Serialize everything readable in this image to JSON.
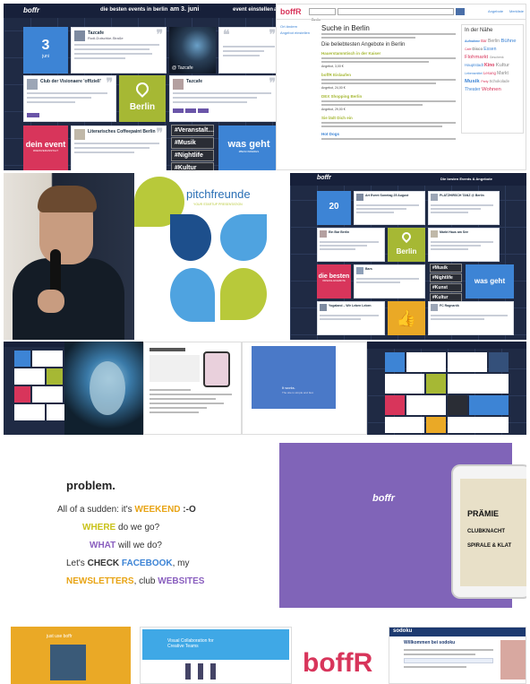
{
  "tile1": {
    "logo": "boffr",
    "header_tagline": "die besten events in berlin",
    "header_date": "am 3. juni",
    "nav": [
      "event einstellen",
      "about"
    ],
    "date_number": "3",
    "date_month": "juni",
    "card_a_title": "Tazcafe",
    "card_a_sub": "Rudi-Dutschke-Straße",
    "card_b_title": "Club der Visionaere 'offiziell'",
    "card_c_title": "Tazcafe",
    "photo_caption": "@ Tazcafe",
    "city_label": "Berlin",
    "card_d_title": "Literarisches Coffeepaint Berlin",
    "dein_event": "dein event",
    "dein_event_sub": "#DEINVERANSTALT",
    "hashtags": [
      "#Veranstalt…",
      "#Musik",
      "#Nightlife",
      "#Kultur"
    ],
    "was_geht": "was geht",
    "was_geht_sub": "#BESONDERES"
  },
  "tile2": {
    "logo": "boffR",
    "search_value": "Berlin",
    "search_button": "Suchen",
    "top_links": [
      "Angebote",
      "Merkliste"
    ],
    "side_links": [
      "Ort ändern",
      "Angebot einstellen"
    ],
    "heading": "Suche in Berlin",
    "section": "Die beliebtesten Angebote in Berlin",
    "right_heading": "In der Nähe",
    "results": [
      {
        "title": "Hauerstammtisch in der Kaiser",
        "price": "Angebot, 3,00 €"
      },
      {
        "title": "boffR Eislaufen",
        "price": "Angebot, 24,00 €"
      },
      {
        "title": "DEX Shopping Berlin",
        "price": "Angebot, 29,00 €"
      },
      {
        "title": "Sie lädt Dich ein",
        "price": ""
      },
      {
        "title": "Hot Dogs",
        "price": ""
      }
    ],
    "tag_cloud": [
      "Aufnahme",
      "Bar",
      "Berlin",
      "Bühne",
      "Café",
      "Disco",
      "Essen",
      "Flohmarkt",
      "Geschenk",
      "Hauptstadt",
      "Kino",
      "Kultur",
      "Lebensmittel",
      "Lesung",
      "Markt",
      "Musik",
      "Party",
      "Schokolade",
      "Theater",
      "Wohnen"
    ]
  },
  "tile4": {
    "brand": "pitchfreunde",
    "tagline": "YOUR STARTUP PRESENTATION"
  },
  "tile5": {
    "header_tagline": "Die besten Events & Angebote",
    "date_number": "20",
    "city_label": "Berlin",
    "die_besten": "die besten",
    "die_besten_sub": "#SPEZIALANGEBOTE",
    "hashtags": [
      "#Musik",
      "#Nightlife",
      "#Kunst",
      "#Kultur"
    ],
    "was_geht": "was geht",
    "card_titles": [
      "Art Event Sonntag 25 August",
      "PLATZHIRSCH TANZ @ Berlin",
      "Ein Bar Berlin",
      "Markt Haus am See",
      "Bars",
      "Yogaland – Wir Leben Leben",
      "FC Ragnarök"
    ]
  },
  "tile8": {
    "text": "It works.",
    "sub": "The site is simple and fast."
  },
  "tile10": {
    "lines": [
      [
        {
          "t": "problem.",
          "c": "#222222",
          "b": true
        }
      ],
      [
        {
          "t": "All of a sudden: it's ",
          "c": "#333333",
          "b": false
        },
        {
          "t": "WEEKEND",
          "c": "#e8a415",
          "b": true
        },
        {
          "t": " :-O",
          "c": "#333333",
          "b": true
        }
      ],
      [
        {
          "t": "WHERE",
          "c": "#c9c21a",
          "b": true
        },
        {
          "t": " do we go?",
          "c": "#333333",
          "b": false
        }
      ],
      [
        {
          "t": "WHAT",
          "c": "#8a5fbf",
          "b": true
        },
        {
          "t": " will we do?",
          "c": "#333333",
          "b": false
        }
      ],
      [
        {
          "t": "Let's ",
          "c": "#333333",
          "b": false
        },
        {
          "t": "CHECK",
          "c": "#333333",
          "b": true
        },
        {
          "t": " FACEBOOK",
          "c": "#3d84d5",
          "b": true
        },
        {
          "t": ", my",
          "c": "#333333",
          "b": false
        }
      ],
      [
        {
          "t": "NEWSLETTERS",
          "c": "#e8a415",
          "b": true
        },
        {
          "t": ", club ",
          "c": "#333333",
          "b": false
        },
        {
          "t": "WEBSITES",
          "c": "#8a5fbf",
          "b": true
        }
      ]
    ]
  },
  "tile11": {
    "logo": "boffr",
    "phone_texts": [
      "PRÄMIE",
      "CLUBKNACHT",
      "SPIRALE & KLAT"
    ]
  },
  "tile13": {
    "title": "Visual Collaboration for Creative Teams"
  },
  "tile14": {
    "logo": "boffR"
  },
  "tile12": {
    "label": "just use boffr"
  },
  "tile15": {
    "logo": "sodoku",
    "headline": "Willkommen bei sodoku"
  },
  "colors": {
    "navy": "#1f2a44",
    "blue": "#3d84d5",
    "green": "#a6b834",
    "pink": "#d8355b",
    "purple": "#8064b8",
    "orange": "#eaa926"
  }
}
